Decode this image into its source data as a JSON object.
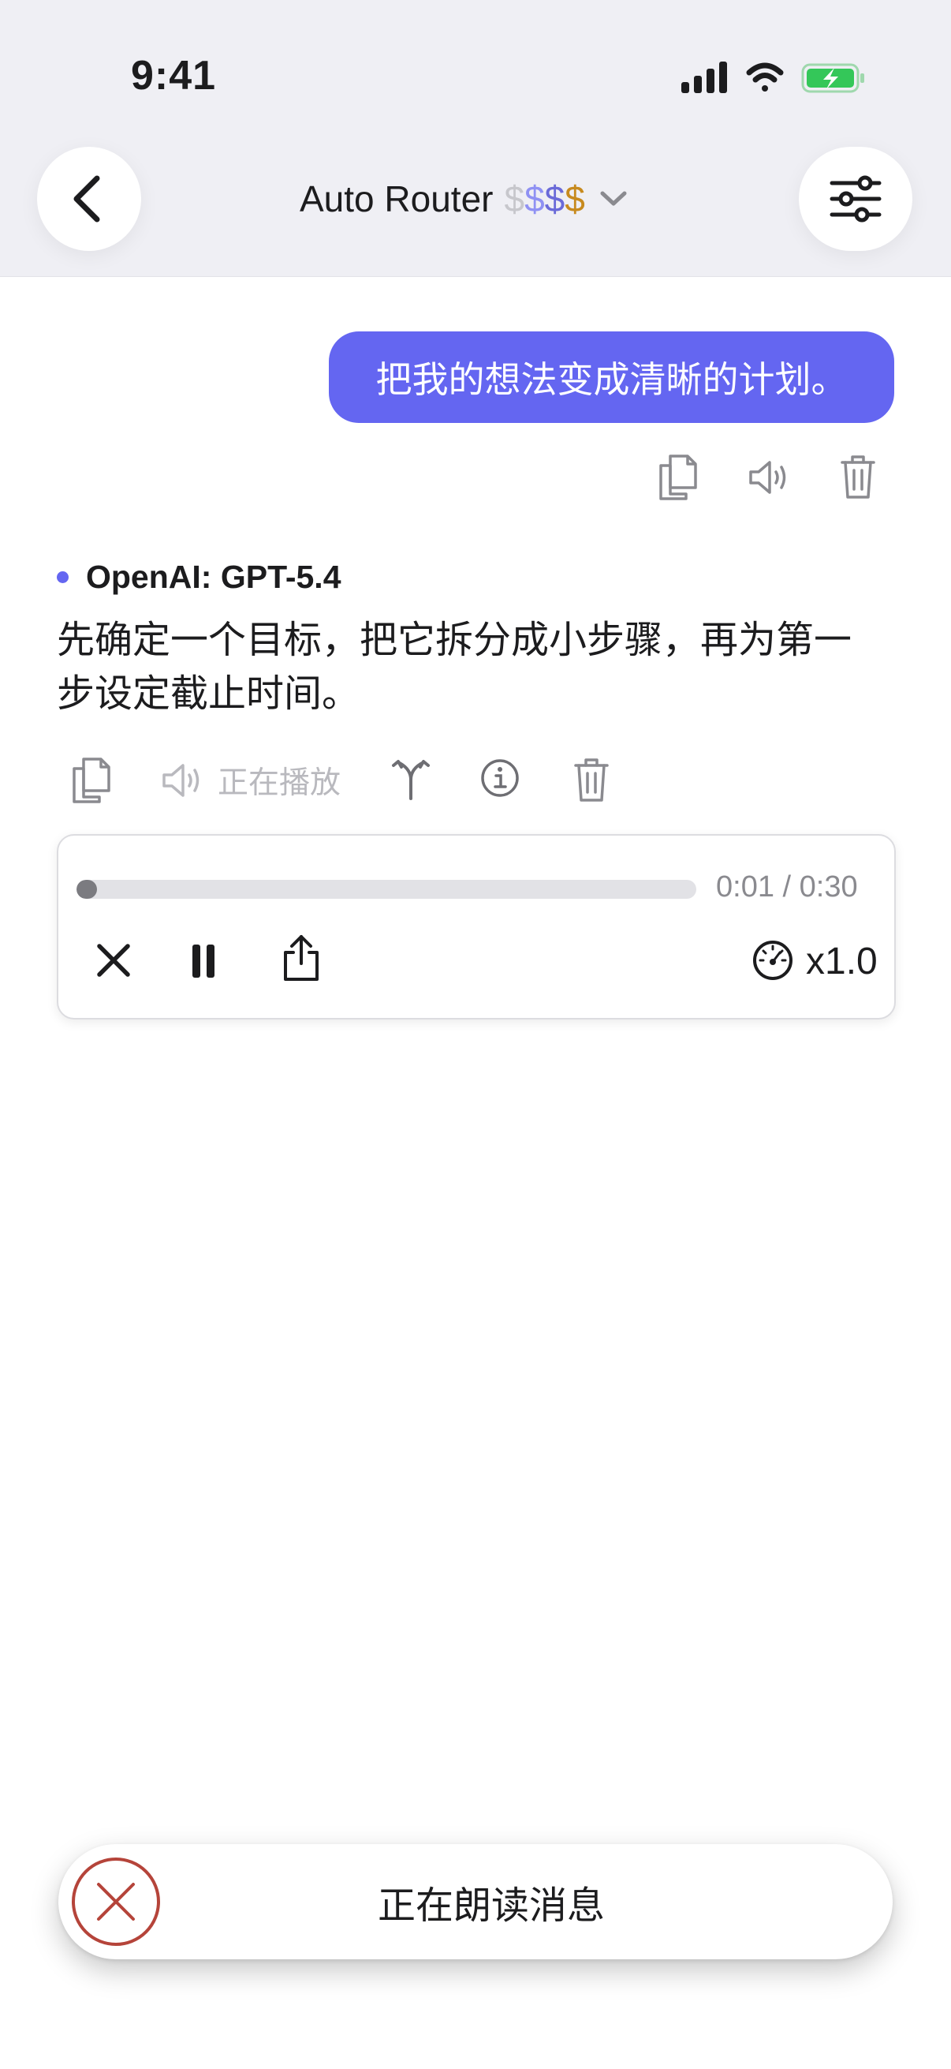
{
  "status_bar": {
    "time": "9:41",
    "signal_icon": "signal-bars-icon",
    "wifi_icon": "wifi-icon",
    "battery_icon": "battery-charging-icon",
    "battery_color": "#34c759"
  },
  "header": {
    "back_icon": "chevron-left-icon",
    "model_name": "Auto Router",
    "price_symbols": [
      {
        "symbol": "$",
        "color": "#c7c7cc"
      },
      {
        "symbol": "$",
        "color": "#8f91f3"
      },
      {
        "symbol": "$",
        "color": "#6a6ad8"
      },
      {
        "symbol": "$",
        "color": "#c78a1e"
      }
    ],
    "dropdown_icon": "chevron-down-icon",
    "settings_icon": "sliders-icon"
  },
  "user_message": {
    "text": "把我的想法变成清晰的计划。",
    "bubble_color": "#6466f1",
    "actions": [
      "copy-icon",
      "speaker-icon",
      "trash-icon"
    ]
  },
  "assistant_message": {
    "model_label": "OpenAI: GPT-5.4",
    "text": "先确定一个目标，把它拆分成小步骤，再为第一步设定截止时间。",
    "playing_label": "正在播放",
    "actions": [
      "copy-icon",
      "speaker-icon",
      "branch-icon",
      "info-icon",
      "trash-icon"
    ]
  },
  "audio_player": {
    "progress": 0.033,
    "time_label": "0:01 / 0:30",
    "speed_label": "x1.0",
    "controls": [
      "close-icon",
      "pause-icon",
      "share-icon",
      "speedometer-icon"
    ]
  },
  "toast": {
    "text": "正在朗读消息",
    "stop_icon": "stop-circle-icon",
    "stop_color": "#b5443a"
  }
}
